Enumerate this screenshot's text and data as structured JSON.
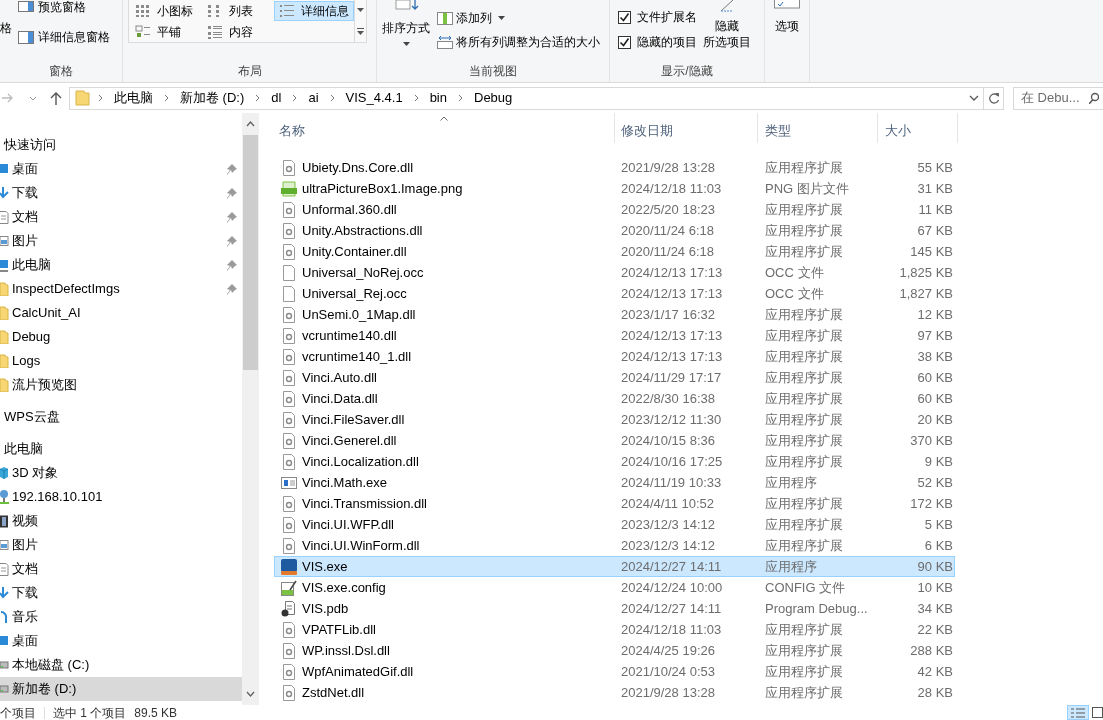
{
  "ribbon": {
    "pane_group": {
      "cut_label": "格",
      "preview_pane": "预览窗格",
      "details_pane": "详细信息窗格",
      "label": "窗格"
    },
    "layout_group": {
      "options": [
        {
          "label": "小图标",
          "selected": false
        },
        {
          "label": "列表",
          "selected": false
        },
        {
          "label": "详细信息",
          "selected": true
        },
        {
          "label": "平铺",
          "selected": false
        },
        {
          "label": "内容",
          "selected": false
        }
      ],
      "label": "布局"
    },
    "view_group": {
      "sort": "排序方式",
      "add_column": "添加列",
      "fit_columns": "将所有列调整为合适的大小",
      "label": "当前视图"
    },
    "show_hide_group": {
      "checkboxes": [
        {
          "label": "文件扩展名",
          "checked": true
        },
        {
          "label": "隐藏的项目",
          "checked": true
        }
      ],
      "hide_selected": [
        "隐藏",
        "所选项目"
      ],
      "label": "显示/隐藏"
    },
    "options_button": "选项"
  },
  "address_bar": {
    "breadcrumbs": [
      "此电脑",
      "新加卷 (D:)",
      "dl",
      "ai",
      "VIS_4.4.1",
      "bin",
      "Debug"
    ]
  },
  "search": {
    "placeholder": "在 Debu..."
  },
  "navigation": [
    {
      "label": "快速访问",
      "kind": "header"
    },
    {
      "label": "桌面",
      "kind": "item",
      "pinned": true,
      "selected": false
    },
    {
      "label": "下载",
      "kind": "item",
      "pinned": true,
      "selected": false
    },
    {
      "label": "文档",
      "kind": "item",
      "pinned": true,
      "selected": false
    },
    {
      "label": "图片",
      "kind": "item",
      "pinned": true,
      "selected": false
    },
    {
      "label": "此电脑",
      "kind": "item",
      "pinned": true,
      "selected": false
    },
    {
      "label": "InspectDefectImgs",
      "kind": "item",
      "pinned": true,
      "selected": false
    },
    {
      "label": "CalcUnit_AI",
      "kind": "item",
      "pinned": false,
      "selected": false
    },
    {
      "label": "Debug",
      "kind": "item",
      "pinned": false,
      "selected": false
    },
    {
      "label": "Logs",
      "kind": "item",
      "pinned": false,
      "selected": false
    },
    {
      "label": "流片预览图",
      "kind": "item",
      "pinned": false,
      "selected": false
    },
    {
      "label": "WPS云盘",
      "kind": "header"
    },
    {
      "label": "此电脑",
      "kind": "header"
    },
    {
      "label": "3D 对象",
      "kind": "item",
      "pinned": false,
      "selected": false
    },
    {
      "label": "192.168.10.101",
      "kind": "item",
      "pinned": false,
      "selected": false
    },
    {
      "label": "视频",
      "kind": "item",
      "pinned": false,
      "selected": false
    },
    {
      "label": "图片",
      "kind": "item",
      "pinned": false,
      "selected": false
    },
    {
      "label": "文档",
      "kind": "item",
      "pinned": false,
      "selected": false
    },
    {
      "label": "下载",
      "kind": "item",
      "pinned": false,
      "selected": false
    },
    {
      "label": "音乐",
      "kind": "item",
      "pinned": false,
      "selected": false
    },
    {
      "label": "桌面",
      "kind": "item",
      "pinned": false,
      "selected": false
    },
    {
      "label": "本地磁盘 (C:)",
      "kind": "item",
      "pinned": false,
      "selected": false
    },
    {
      "label": "新加卷 (D:)",
      "kind": "item",
      "pinned": false,
      "selected": true
    }
  ],
  "table": {
    "columns": [
      {
        "label": "名称",
        "sorted": true
      },
      {
        "label": "修改日期",
        "sorted": false
      },
      {
        "label": "类型",
        "sorted": false
      },
      {
        "label": "大小",
        "sorted": false
      }
    ],
    "rows": [
      {
        "kind": "dll",
        "name": "Ubiety.Dns.Core.dll",
        "date": "2021/9/28 13:28",
        "type": "应用程序扩展",
        "size": "55 KB",
        "selected": false
      },
      {
        "kind": "png",
        "name": "ultraPictureBox1.Image.png",
        "date": "2024/12/18 11:03",
        "type": "PNG 图片文件",
        "size": "31 KB",
        "selected": false
      },
      {
        "kind": "dll",
        "name": "Unformal.360.dll",
        "date": "2022/5/20 18:23",
        "type": "应用程序扩展",
        "size": "11 KB",
        "selected": false
      },
      {
        "kind": "dll",
        "name": "Unity.Abstractions.dll",
        "date": "2020/11/24 6:18",
        "type": "应用程序扩展",
        "size": "67 KB",
        "selected": false
      },
      {
        "kind": "dll",
        "name": "Unity.Container.dll",
        "date": "2020/11/24 6:18",
        "type": "应用程序扩展",
        "size": "145 KB",
        "selected": false
      },
      {
        "kind": "file",
        "name": "Universal_NoRej.occ",
        "date": "2024/12/13 17:13",
        "type": "OCC 文件",
        "size": "1,825 KB",
        "selected": false
      },
      {
        "kind": "file",
        "name": "Universal_Rej.occ",
        "date": "2024/12/13 17:13",
        "type": "OCC 文件",
        "size": "1,827 KB",
        "selected": false
      },
      {
        "kind": "dll",
        "name": "UnSemi.0_1Map.dll",
        "date": "2023/1/17 16:32",
        "type": "应用程序扩展",
        "size": "12 KB",
        "selected": false
      },
      {
        "kind": "dll",
        "name": "vcruntime140.dll",
        "date": "2024/12/13 17:13",
        "type": "应用程序扩展",
        "size": "97 KB",
        "selected": false
      },
      {
        "kind": "dll",
        "name": "vcruntime140_1.dll",
        "date": "2024/12/13 17:13",
        "type": "应用程序扩展",
        "size": "38 KB",
        "selected": false
      },
      {
        "kind": "dll",
        "name": "Vinci.Auto.dll",
        "date": "2024/11/29 17:17",
        "type": "应用程序扩展",
        "size": "60 KB",
        "selected": false
      },
      {
        "kind": "dll",
        "name": "Vinci.Data.dll",
        "date": "2022/8/30 16:38",
        "type": "应用程序扩展",
        "size": "60 KB",
        "selected": false
      },
      {
        "kind": "dll",
        "name": "Vinci.FileSaver.dll",
        "date": "2023/12/12 11:30",
        "type": "应用程序扩展",
        "size": "20 KB",
        "selected": false
      },
      {
        "kind": "dll",
        "name": "Vinci.Generel.dll",
        "date": "2024/10/15 8:36",
        "type": "应用程序扩展",
        "size": "370 KB",
        "selected": false
      },
      {
        "kind": "dll",
        "name": "Vinci.Localization.dll",
        "date": "2024/10/16 17:25",
        "type": "应用程序扩展",
        "size": "9 KB",
        "selected": false
      },
      {
        "kind": "app",
        "name": "Vinci.Math.exe",
        "date": "2024/11/19 10:33",
        "type": "应用程序",
        "size": "52 KB",
        "selected": false
      },
      {
        "kind": "dll",
        "name": "Vinci.Transmission.dll",
        "date": "2024/4/11 10:52",
        "type": "应用程序扩展",
        "size": "172 KB",
        "selected": false
      },
      {
        "kind": "dll",
        "name": "Vinci.UI.WFP.dll",
        "date": "2023/12/3 14:12",
        "type": "应用程序扩展",
        "size": "5 KB",
        "selected": false
      },
      {
        "kind": "dll",
        "name": "Vinci.UI.WinForm.dll",
        "date": "2023/12/3 14:12",
        "type": "应用程序扩展",
        "size": "6 KB",
        "selected": false
      },
      {
        "kind": "vis",
        "name": "VIS.exe",
        "date": "2024/12/27 14:11",
        "type": "应用程序",
        "size": "90 KB",
        "selected": true
      },
      {
        "kind": "config",
        "name": "VIS.exe.config",
        "date": "2024/12/24 10:00",
        "type": "CONFIG 文件",
        "size": "10 KB",
        "selected": false
      },
      {
        "kind": "pdb",
        "name": "VIS.pdb",
        "date": "2024/12/27 14:11",
        "type": "Program Debug...",
        "size": "34 KB",
        "selected": false
      },
      {
        "kind": "dll",
        "name": "VPATFLib.dll",
        "date": "2024/12/18 11:03",
        "type": "应用程序扩展",
        "size": "22 KB",
        "selected": false
      },
      {
        "kind": "dll",
        "name": "WP.inssl.Dsl.dll",
        "date": "2024/4/25 19:26",
        "type": "应用程序扩展",
        "size": "288 KB",
        "selected": false
      },
      {
        "kind": "dll",
        "name": "WpfAnimatedGif.dll",
        "date": "2021/10/24 0:53",
        "type": "应用程序扩展",
        "size": "42 KB",
        "selected": false
      },
      {
        "kind": "dll",
        "name": "ZstdNet.dll",
        "date": "2021/9/28 13:28",
        "type": "应用程序扩展",
        "size": "28 KB",
        "selected": false
      }
    ]
  },
  "status_bar": {
    "item_count": "个项目",
    "selection": "选中 1 个项目",
    "selection_size": "89.5 KB"
  }
}
